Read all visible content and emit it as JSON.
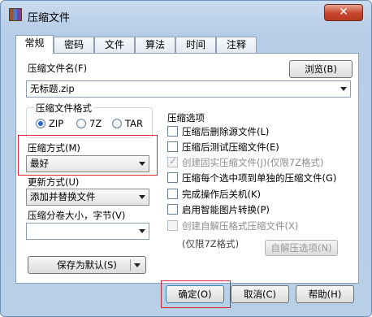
{
  "window": {
    "title": "压缩文件",
    "close_glyph": "✕"
  },
  "tabs": [
    "常规",
    "密码",
    "文件",
    "算法",
    "时间",
    "注释"
  ],
  "general": {
    "archive_name_label": "压缩文件名(F)",
    "browse_button": "浏览(B)",
    "archive_name_value": "无标题.zip",
    "format_group_title": "压缩文件格式",
    "formats": [
      "ZIP",
      "7Z",
      "TAR"
    ],
    "selected_format": "ZIP",
    "method_label": "压缩方式(M)",
    "method_value": "最好",
    "update_label": "更新方式(U)",
    "update_value": "添加并替换文件",
    "split_label": "压缩分卷大小，字节(V)",
    "split_value": "",
    "save_default_button": "保存为默认(S)",
    "options_group_title": "压缩选项",
    "options": [
      {
        "label": "压缩后删除源文件(L)",
        "checked": false,
        "disabled": false
      },
      {
        "label": "压缩后测试压缩文件(E)",
        "checked": false,
        "disabled": false
      },
      {
        "label": "创建固实压缩文件(J)(仅限7Z格式)",
        "checked": true,
        "disabled": true
      },
      {
        "label": "压缩每个选中项到单独的压缩文件(G)",
        "checked": false,
        "disabled": false
      },
      {
        "label": "完成操作后关机(K)",
        "checked": false,
        "disabled": false
      },
      {
        "label": "启用智能图片转换(P)",
        "checked": false,
        "disabled": false
      },
      {
        "label": "创建自解压格式压缩文件(X)",
        "checked": false,
        "disabled": true
      }
    ],
    "sfx_note": "(仅限7Z格式)",
    "sfx_options_button": "自解压选项(N)"
  },
  "buttons": {
    "ok": "确定(O)",
    "cancel": "取消(C)",
    "help": "帮助(H)"
  },
  "colors": {
    "highlight": "#d9282f",
    "accent": "#2b68c2"
  }
}
